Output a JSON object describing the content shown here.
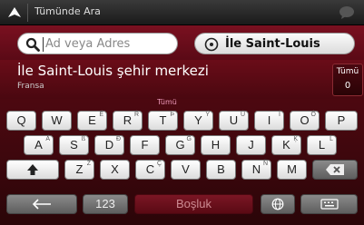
{
  "top_bar": {
    "title": "Tümünde Ara",
    "nav_icon": "navigation-arrow-icon",
    "message_icon": "speech-bubble-icon"
  },
  "search": {
    "placeholder": "Ad veya Adres",
    "place_label": "İle Saint-Louis"
  },
  "result": {
    "name": "İle Saint-Louis şehir merkezi",
    "country": "Fransa",
    "count_label": "Tümü",
    "count_value": "0"
  },
  "mid_label": "Tümü",
  "keyboard": {
    "row1": [
      {
        "key": "Q",
        "sub": ""
      },
      {
        "key": "W",
        "sub": ""
      },
      {
        "key": "E",
        "sub": "É"
      },
      {
        "key": "R",
        "sub": "Ŕ"
      },
      {
        "key": "T",
        "sub": "Þ"
      },
      {
        "key": "Y",
        "sub": "Ý"
      },
      {
        "key": "U",
        "sub": "Ú"
      },
      {
        "key": "I",
        "sub": "Í"
      },
      {
        "key": "O",
        "sub": "Ó"
      },
      {
        "key": "P",
        "sub": ""
      }
    ],
    "row2": [
      {
        "key": "A",
        "sub": "Á"
      },
      {
        "key": "S",
        "sub": "ß"
      },
      {
        "key": "D",
        "sub": "Ð"
      },
      {
        "key": "F",
        "sub": ""
      },
      {
        "key": "G",
        "sub": "Ğ"
      },
      {
        "key": "H",
        "sub": ""
      },
      {
        "key": "J",
        "sub": ""
      },
      {
        "key": "K",
        "sub": "Ķ"
      },
      {
        "key": "L",
        "sub": "Ĺ"
      }
    ],
    "row3": [
      {
        "key": "Z",
        "sub": "Ź"
      },
      {
        "key": "X",
        "sub": ""
      },
      {
        "key": "C",
        "sub": "Ç"
      },
      {
        "key": "V",
        "sub": ""
      },
      {
        "key": "B",
        "sub": ""
      },
      {
        "key": "N",
        "sub": "Ñ"
      },
      {
        "key": "M",
        "sub": ""
      }
    ],
    "numbers_label": "123",
    "space_label": "Boşluk"
  }
}
